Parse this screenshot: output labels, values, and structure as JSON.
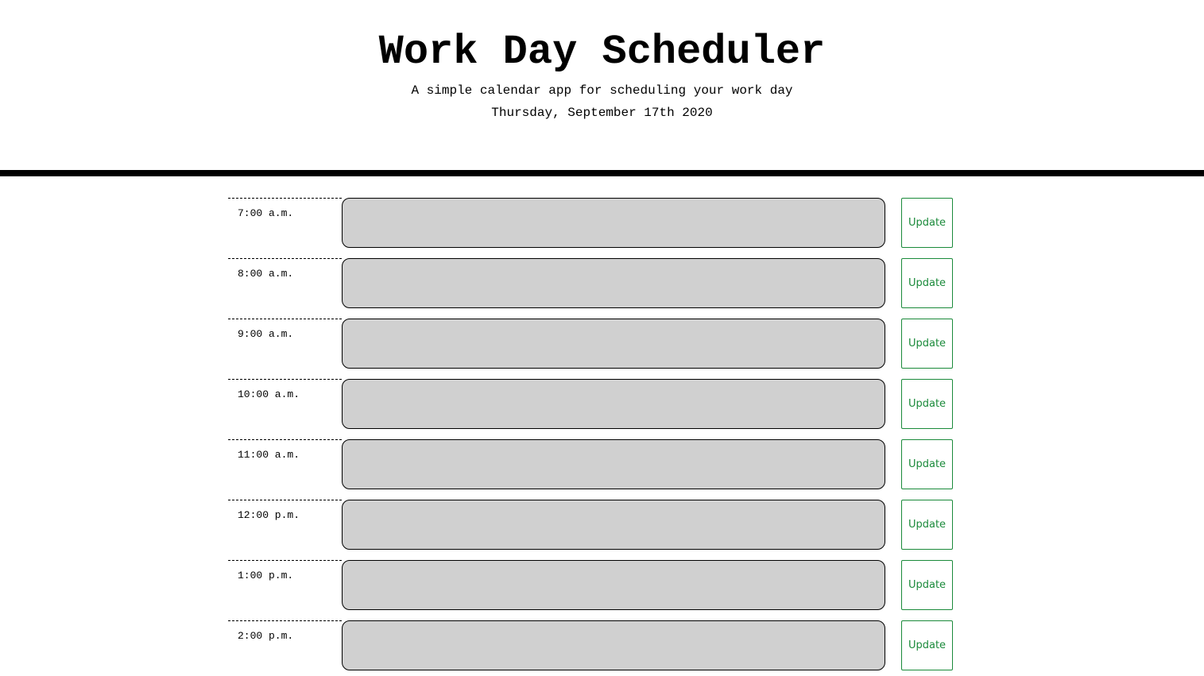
{
  "header": {
    "title": "Work Day Scheduler",
    "subtitle": "A simple calendar app for scheduling your work day",
    "date": "Thursday, September 17th 2020"
  },
  "colors": {
    "entry_background": "#d0d0d0",
    "button_accent": "#1a8a3a",
    "divider": "#000000"
  },
  "schedule": {
    "rows": [
      {
        "hour": "7:00 a.m.",
        "entry": "",
        "button_label": "Update"
      },
      {
        "hour": "8:00 a.m.",
        "entry": "",
        "button_label": "Update"
      },
      {
        "hour": "9:00 a.m.",
        "entry": "",
        "button_label": "Update"
      },
      {
        "hour": "10:00 a.m.",
        "entry": "",
        "button_label": "Update"
      },
      {
        "hour": "11:00 a.m.",
        "entry": "",
        "button_label": "Update"
      },
      {
        "hour": "12:00 p.m.",
        "entry": "",
        "button_label": "Update"
      },
      {
        "hour": "1:00 p.m.",
        "entry": "",
        "button_label": "Update"
      },
      {
        "hour": "2:00 p.m.",
        "entry": "",
        "button_label": "Update"
      }
    ]
  }
}
